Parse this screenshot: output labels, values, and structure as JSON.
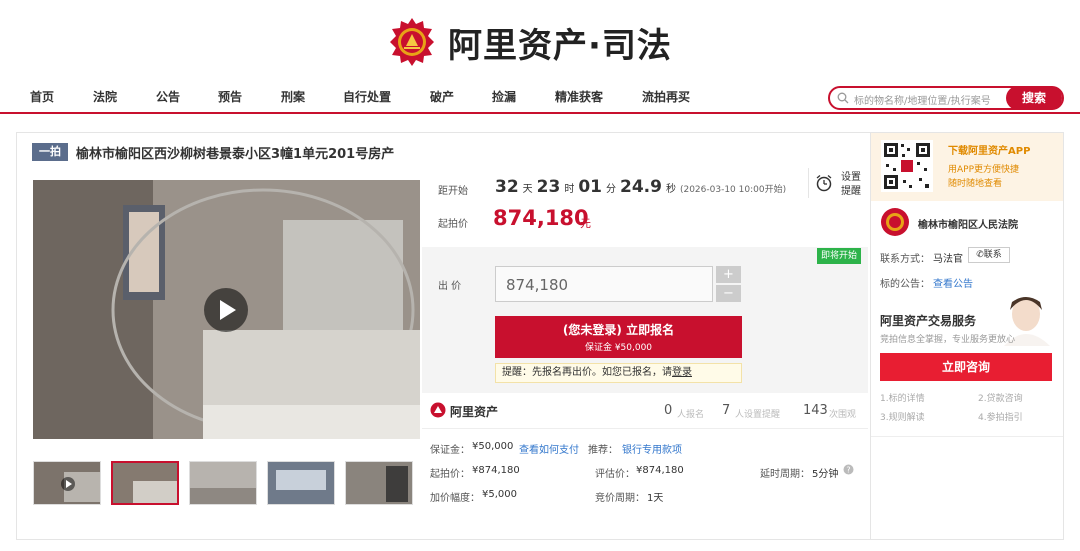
{
  "brand": {
    "title": "阿里资产·司法"
  },
  "nav": {
    "items": [
      "首页",
      "法院",
      "公告",
      "预告",
      "刑案",
      "自行处置",
      "破产",
      "捡漏",
      "精准获客",
      "流拍再买"
    ]
  },
  "search": {
    "placeholder": "标的物名称/地理位置/执行案号",
    "button": "搜索"
  },
  "item": {
    "badge": "一拍",
    "title": "榆林市榆阳区西沙柳树巷景泰小区3幢1单元201号房产"
  },
  "countdown": {
    "label": "距开始",
    "days": "32",
    "days_unit": "天",
    "hours": "23",
    "hours_unit": "时",
    "minutes": "01",
    "minutes_unit": "分",
    "seconds": "24.9",
    "seconds_unit": "秒",
    "start_note": "(2026-03-10 10:00开始)"
  },
  "reminder": {
    "line1": "设置",
    "line2": "提醒"
  },
  "start_price": {
    "label": "起拍价",
    "value": "874,180",
    "unit": "元"
  },
  "bid": {
    "tag": "即将开始",
    "label": "出 价",
    "value": "874,180",
    "plus": "+",
    "minus": "−"
  },
  "register": {
    "main": "(您未登录) 立即报名",
    "sub": "保证金 ¥50,000"
  },
  "notice": {
    "text": "提醒：先报名再出价。如您已报名，请",
    "link": "登录"
  },
  "stats": {
    "brand": "阿里资产",
    "registered_count": "0",
    "registered_label": "人报名",
    "reminder_count": "7",
    "reminder_label": "人设置提醒",
    "view_count": "143",
    "view_label": "次围观"
  },
  "details": {
    "deposit_label": "保证金：",
    "deposit_value": "¥50,000",
    "deposit_link": "查看如何支付",
    "recommend_label": "推荐：",
    "recommend_link": "银行专用款项",
    "start_label": "起拍价：",
    "start_value": "¥874,180",
    "eval_label": "评估价：",
    "eval_value": "¥874,180",
    "delay_label": "延时周期：",
    "delay_value": "5分钟",
    "increment_label": "加价幅度：",
    "increment_value": "¥5,000",
    "cycle_label": "竞价周期：",
    "cycle_value": "1天"
  },
  "sidebar": {
    "app_title": "下载阿里资产APP",
    "app_sub1": "用APP更方便快捷",
    "app_sub2": "随时随地查看",
    "court_name": "榆林市榆阳区人民法院",
    "contact_label": "联系方式：",
    "contact_name": "马法官",
    "contact_btn": "联系",
    "notice_label": "标的公告：",
    "notice_link": "查看公告",
    "service_title": "阿里资产交易服务",
    "service_sub": "竞拍信息全掌握，专业服务更放心",
    "consult_btn": "立即咨询",
    "links": [
      "1.标的详情",
      "2.贷款咨询",
      "3.规则解读",
      "4.参拍指引"
    ]
  },
  "colors": {
    "brand_red": "#c8102e",
    "link_blue": "#3377cc",
    "tag_green": "#2db34a"
  }
}
